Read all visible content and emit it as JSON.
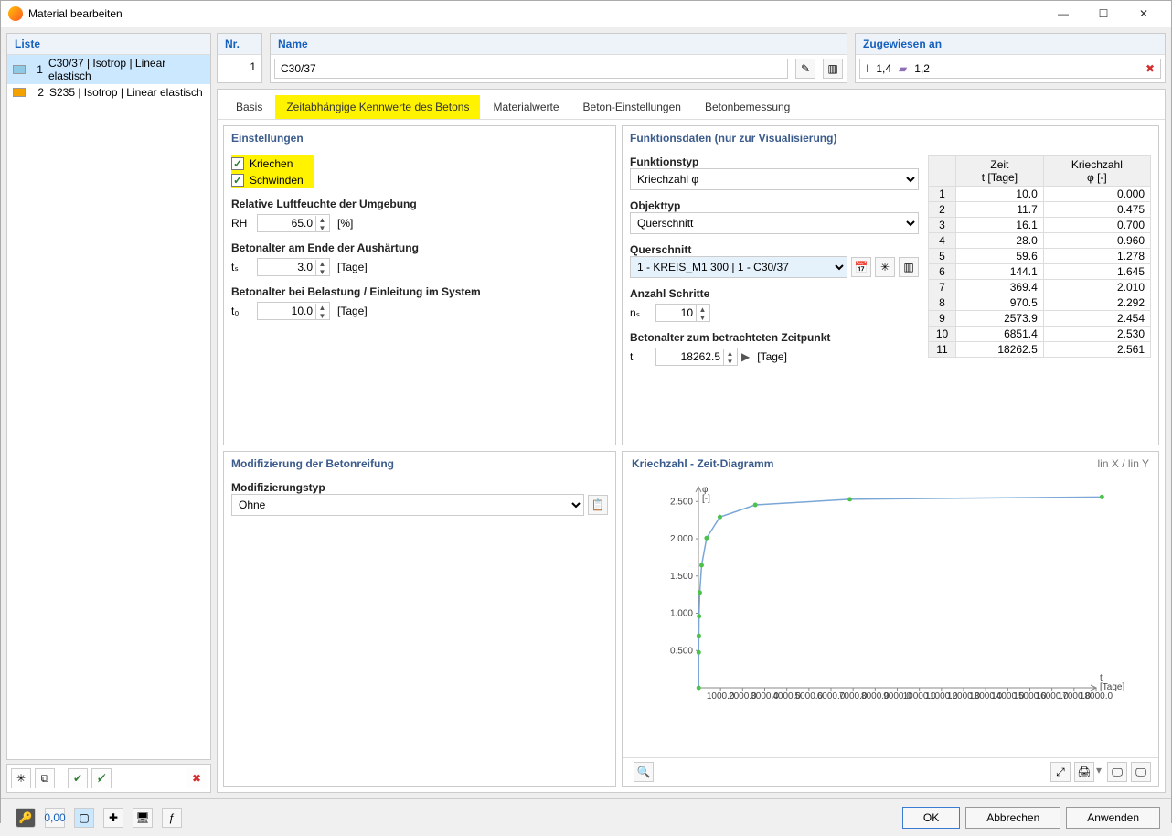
{
  "window": {
    "title": "Material bearbeiten"
  },
  "list": {
    "header": "Liste",
    "items": [
      {
        "n": "1",
        "label": "C30/37 | Isotrop | Linear elastisch",
        "color": "#8ecae6"
      },
      {
        "n": "2",
        "label": "S235 | Isotrop | Linear elastisch",
        "color": "#f4a100"
      }
    ]
  },
  "top": {
    "nr_label": "Nr.",
    "nr_value": "1",
    "name_label": "Name",
    "name_value": "C30/37",
    "assigned_label": "Zugewiesen an",
    "assigned_1": "1,4",
    "assigned_2": "1,2"
  },
  "tabs": {
    "basis": "Basis",
    "time": "Zeitabhängige Kennwerte des Betons",
    "material": "Materialwerte",
    "beton": "Beton-Einstellungen",
    "bemess": "Betonbemessung"
  },
  "einst": {
    "header": "Einstellungen",
    "kriechen": "Kriechen",
    "schwinden": "Schwinden",
    "rh_label": "Relative Luftfeuchte der Umgebung",
    "rh_sym": "RH",
    "rh_val": "65.0",
    "rh_unit": "[%]",
    "ts_label": "Betonalter am Ende der Aushärtung",
    "ts_sym": "tₛ",
    "ts_val": "3.0",
    "ts_unit": "[Tage]",
    "t0_label": "Betonalter bei Belastung / Einleitung im System",
    "t0_sym": "t₀",
    "t0_val": "10.0",
    "t0_unit": "[Tage]"
  },
  "funk": {
    "header": "Funktionsdaten (nur zur Visualisierung)",
    "ftyp_label": "Funktionstyp",
    "ftyp_val": "Kriechzahl φ",
    "otyp_label": "Objekttyp",
    "otyp_val": "Querschnitt",
    "qs_label": "Querschnitt",
    "qs_val": "1 - KREIS_M1 300 | 1 - C30/37",
    "ns_label": "Anzahl Schritte",
    "ns_sym": "nₛ",
    "ns_val": "10",
    "t_label": "Betonalter zum betrachteten Zeitpunkt",
    "t_sym": "t",
    "t_val": "18262.5",
    "t_unit": "[Tage]",
    "col_zeit": "Zeit",
    "col_zeit_u": "t [Tage]",
    "col_k": "Kriechzahl",
    "col_k_u": "φ [-]"
  },
  "rows": [
    {
      "n": "1",
      "t": "10.0",
      "v": "0.000"
    },
    {
      "n": "2",
      "t": "11.7",
      "v": "0.475"
    },
    {
      "n": "3",
      "t": "16.1",
      "v": "0.700"
    },
    {
      "n": "4",
      "t": "28.0",
      "v": "0.960"
    },
    {
      "n": "5",
      "t": "59.6",
      "v": "1.278"
    },
    {
      "n": "6",
      "t": "144.1",
      "v": "1.645"
    },
    {
      "n": "7",
      "t": "369.4",
      "v": "2.010"
    },
    {
      "n": "8",
      "t": "970.5",
      "v": "2.292"
    },
    {
      "n": "9",
      "t": "2573.9",
      "v": "2.454"
    },
    {
      "n": "10",
      "t": "6851.4",
      "v": "2.530"
    },
    {
      "n": "11",
      "t": "18262.5",
      "v": "2.561"
    }
  ],
  "mod": {
    "header": "Modifizierung der Betonreifung",
    "typ_label": "Modifizierungstyp",
    "typ_val": "Ohne"
  },
  "chart": {
    "title": "Kriechzahl - Zeit-Diagramm",
    "axes_mode": "lin X / lin Y",
    "ylabel": "φ",
    "yunit": "[-]",
    "xlabel": "t",
    "xunit": "[Tage]"
  },
  "chart_data": {
    "type": "line",
    "title": "Kriechzahl - Zeit-Diagramm",
    "xlabel": "t [Tage]",
    "ylabel": "φ [-]",
    "xlim": [
      0,
      18000
    ],
    "ylim": [
      0,
      2.7
    ],
    "yticks": [
      0.5,
      1.0,
      1.5,
      2.0,
      2.5
    ],
    "xticks": [
      1000,
      2000,
      3000,
      4000,
      5000,
      6000,
      7000,
      8000,
      9000,
      10000,
      11000,
      12000,
      13000,
      14000,
      15000,
      16000,
      17000,
      18000
    ],
    "x": [
      10.0,
      11.7,
      16.1,
      28.0,
      59.6,
      144.1,
      369.4,
      970.5,
      2573.9,
      6851.4,
      18262.5
    ],
    "y": [
      0.0,
      0.475,
      0.7,
      0.96,
      1.278,
      1.645,
      2.01,
      2.292,
      2.454,
      2.53,
      2.561
    ]
  },
  "buttons": {
    "ok": "OK",
    "cancel": "Abbrechen",
    "apply": "Anwenden"
  }
}
